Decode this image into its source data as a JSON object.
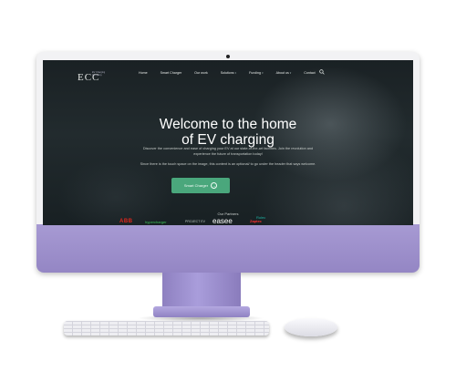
{
  "site": {
    "logo": {
      "mark": "ECC",
      "subtitle": "EV Charging Company"
    },
    "nav": {
      "items": [
        {
          "label": "Home",
          "has_dropdown": false
        },
        {
          "label": "Smart Charger",
          "has_dropdown": false
        },
        {
          "label": "Our work",
          "has_dropdown": false
        },
        {
          "label": "Solutions",
          "has_dropdown": true
        },
        {
          "label": "Funding",
          "has_dropdown": true
        },
        {
          "label": "About us",
          "has_dropdown": true
        },
        {
          "label": "Contact",
          "has_dropdown": false
        }
      ],
      "search_icon": "search-icon"
    },
    "hero": {
      "title_line1": "Welcome to the home",
      "title_line2": "of EV charging",
      "description": "Discover the convenience and ease of charging your EV at our state-of-the-art facilities. Join the revolution and experience the future of transportation today!",
      "note": "Since there is the touch space on the image, this content is an optional/ to go under the header that says welcome.",
      "cta_label": "Smart Charger",
      "cta_icon": "arrow-right-circle-icon"
    },
    "partners": {
      "title": "Our Partners",
      "logos": [
        "ABB",
        "hypercharger",
        "PROJECT EV",
        "easee",
        "Zaptec",
        "Rolec"
      ]
    }
  },
  "colors": {
    "accent_green": "#4aa77c",
    "device_purple": "#a79ad3",
    "abb_red": "#e0261c"
  }
}
